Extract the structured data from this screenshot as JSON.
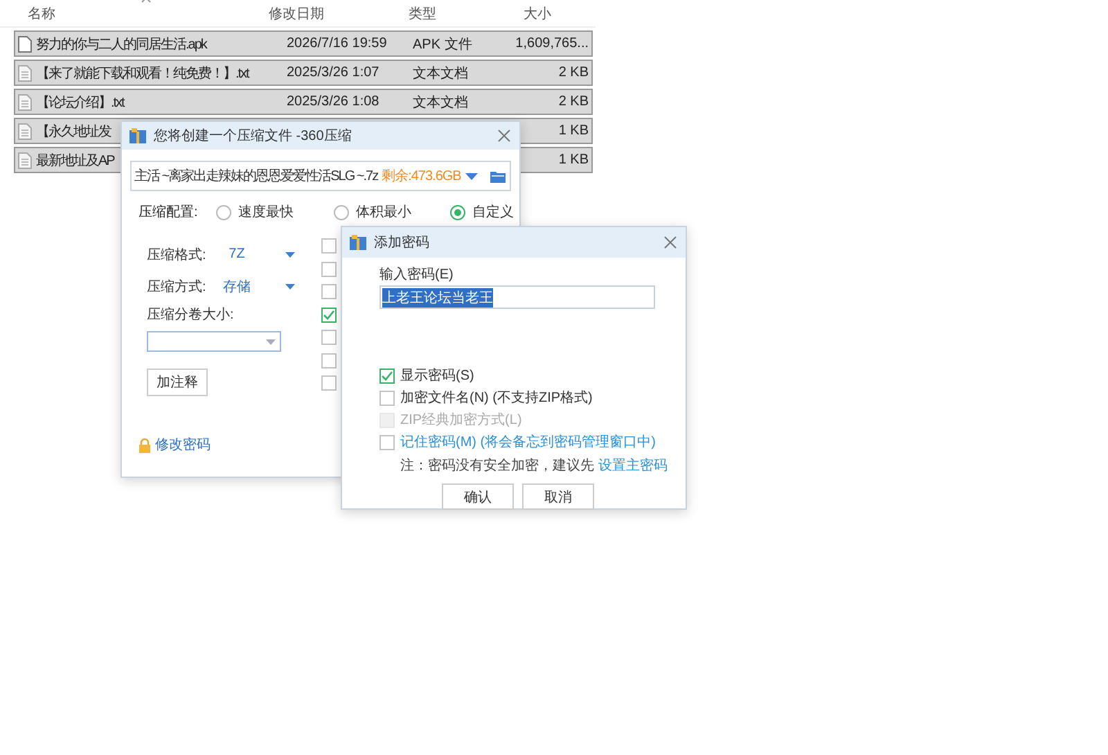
{
  "file_list": {
    "columns": [
      "名称",
      "修改日期",
      "类型",
      "大小"
    ],
    "rows": [
      {
        "kind": "apk",
        "name": "努力的你与二人的同居生活.apk",
        "date": "2026/7/16 19:59",
        "type": "APK 文件",
        "size": "1,609,765...",
        "selected": true
      },
      {
        "kind": "txt",
        "name": "【来了就能下载和观看！纯免费！】.txt",
        "date": "2025/3/26 1:07",
        "type": "文本文档",
        "size": "2 KB",
        "selected": true
      },
      {
        "kind": "txt",
        "name": "【论坛介绍】.txt",
        "date": "2025/3/26 1:08",
        "type": "文本文档",
        "size": "2 KB",
        "selected": true
      },
      {
        "kind": "txt",
        "name": "【永久地址发",
        "size": "1 KB",
        "selected": true
      },
      {
        "kind": "txt",
        "name": "最新地址及AP",
        "size": "1 KB",
        "selected": true
      }
    ]
  },
  "compress_dialog": {
    "title": "您将创建一个压缩文件 -360压缩",
    "path": "主活 ~离家出走辣妹的恩恩爱爱性活SLG ~.7z",
    "free_space": "剩余:473.6GB",
    "config_label": "压缩配置:",
    "presets": [
      {
        "label": "速度最快",
        "selected": false
      },
      {
        "label": "体积最小",
        "selected": false
      },
      {
        "label": "自定义",
        "selected": true
      }
    ],
    "format_label": "压缩格式:",
    "format": "7Z",
    "method_label": "压缩方式:",
    "method": "存储",
    "split_label": "压缩分卷大小:",
    "comment_button": "加注释",
    "options": [
      {
        "checked": false
      },
      {
        "checked": false
      },
      {
        "checked": false
      },
      {
        "checked": true
      },
      {
        "checked": false
      },
      {
        "checked": false
      },
      {
        "checked": false
      }
    ],
    "password_link": "修改密码"
  },
  "password_dialog": {
    "title": "添加密码",
    "password_label": "输入密码(E)",
    "password": "上老王论坛当老王",
    "options": [
      {
        "kind": "plain",
        "label": "显示密码(S)",
        "checked": true,
        "disabled": false
      },
      {
        "kind": "plain",
        "label": "加密文件名(N) (不支持ZIP格式)",
        "checked": false,
        "disabled": false
      },
      {
        "kind": "plain",
        "label": "ZIP经典加密方式(L)",
        "checked": false,
        "disabled": true
      },
      {
        "kind": "link",
        "label": "记住密码(M) (将会备忘到密码管理窗口中)",
        "checked": false,
        "disabled": false
      }
    ],
    "note": "注：密码没有安全加密，建议先",
    "note_link": "设置主密码",
    "buttons": [
      "确认",
      "取消"
    ]
  }
}
